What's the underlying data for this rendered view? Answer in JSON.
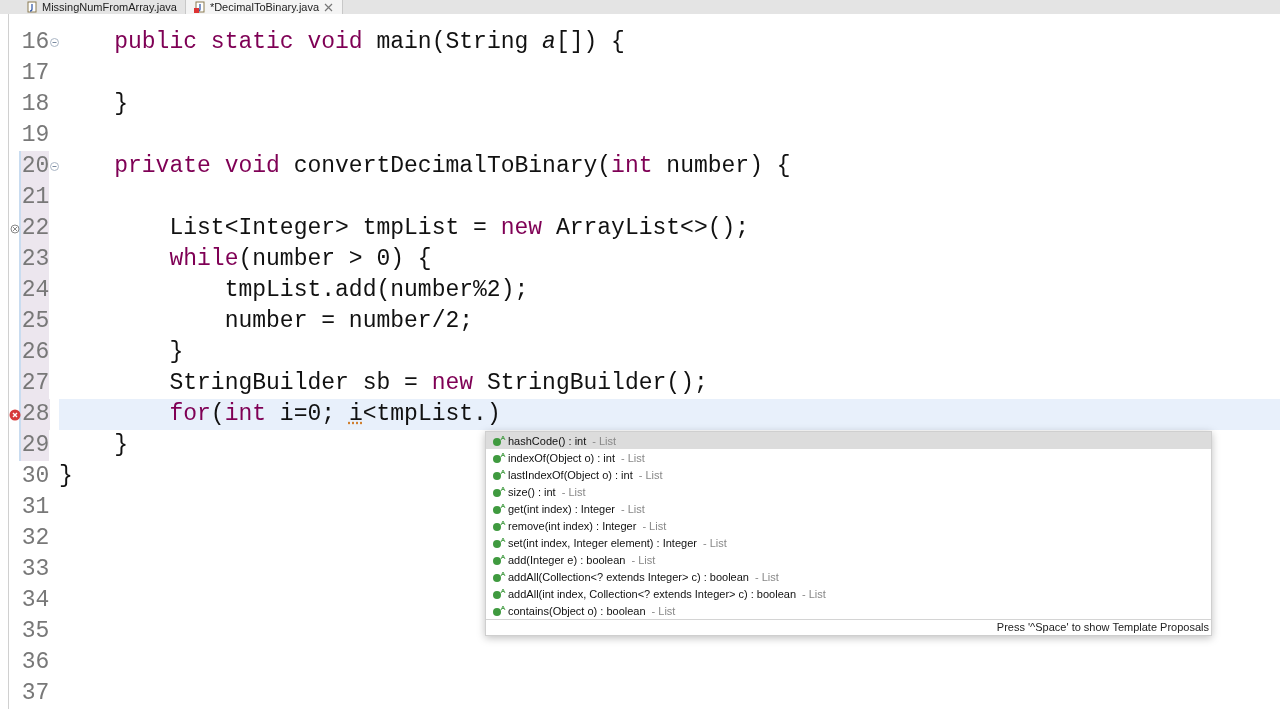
{
  "tabs": [
    {
      "label": "MissingNumFromArray.java",
      "selected": false,
      "dirty_error": false
    },
    {
      "label": "*DecimalToBinary.java",
      "selected": true,
      "dirty_error": true
    }
  ],
  "editor": {
    "lines": [
      {
        "number": "16",
        "foldable": true,
        "current": false,
        "in_range": false,
        "segments": [
          {
            "text": "    public static void",
            "kind": "keyword"
          },
          {
            "text": " main(String "
          },
          {
            "text": "a",
            "kind": "param"
          },
          {
            "text": "[]) {"
          }
        ]
      },
      {
        "number": "17",
        "current": false,
        "in_range": false
      },
      {
        "number": "18",
        "current": false,
        "in_range": false,
        "segments": [
          {
            "text": "    }"
          }
        ]
      },
      {
        "number": "19",
        "current": false,
        "in_range": false
      },
      {
        "number": "20",
        "foldable": true,
        "current": false,
        "in_range": true,
        "segments": [
          {
            "text": "    private void",
            "kind": "keyword"
          },
          {
            "text": " convertDecimalToBinary("
          },
          {
            "text": "int",
            "kind": "keyword"
          },
          {
            "text": " number) {"
          }
        ]
      },
      {
        "number": "21",
        "current": false,
        "in_range": true
      },
      {
        "number": "22",
        "warning": true,
        "current": false,
        "in_range": true,
        "segments": [
          {
            "text": "        List<Integer> tmpList = "
          },
          {
            "text": "new",
            "kind": "keyword"
          },
          {
            "text": " ArrayList<>();"
          }
        ]
      },
      {
        "number": "23",
        "current": false,
        "in_range": true,
        "segments": [
          {
            "text": "        while",
            "kind": "keyword"
          },
          {
            "text": "(number > 0) {"
          }
        ]
      },
      {
        "number": "24",
        "current": false,
        "in_range": true,
        "segments": [
          {
            "text": "            tmpList.add(number%2);"
          }
        ]
      },
      {
        "number": "25",
        "current": false,
        "in_range": true,
        "segments": [
          {
            "text": "            number = number/2;"
          }
        ]
      },
      {
        "number": "26",
        "current": false,
        "in_range": true,
        "segments": [
          {
            "text": "        }"
          }
        ]
      },
      {
        "number": "27",
        "current": false,
        "in_range": true,
        "segments": [
          {
            "text": "        StringBuilder sb = "
          },
          {
            "text": "new",
            "kind": "keyword"
          },
          {
            "text": " StringBuilder();"
          }
        ]
      },
      {
        "number": "28",
        "error": true,
        "current": true,
        "in_range": true,
        "segments": [
          {
            "text": "        for",
            "kind": "keyword"
          },
          {
            "text": "("
          },
          {
            "text": "int",
            "kind": "keyword"
          },
          {
            "text": " i=0; "
          },
          {
            "text": "i",
            "kind": "flagged"
          },
          {
            "text": "<tmpList.)"
          }
        ]
      },
      {
        "number": "29",
        "current": false,
        "in_range": true,
        "segments": [
          {
            "text": "    }"
          }
        ]
      },
      {
        "number": "30",
        "current": false,
        "in_range": false,
        "segments": [
          {
            "text": "}"
          }
        ]
      },
      {
        "number": "31",
        "current": false,
        "in_range": false
      },
      {
        "number": "32",
        "current": false,
        "in_range": false
      },
      {
        "number": "33",
        "current": false,
        "in_range": false
      },
      {
        "number": "34",
        "current": false,
        "in_range": false
      },
      {
        "number": "35",
        "current": false,
        "in_range": false
      },
      {
        "number": "36",
        "current": false,
        "in_range": false
      },
      {
        "number": "37",
        "current": false,
        "in_range": false
      }
    ]
  },
  "completion": {
    "items": [
      {
        "signature": "hashCode() : int",
        "owner": "- List",
        "selected": true
      },
      {
        "signature": "indexOf(Object o) : int",
        "owner": "- List",
        "selected": false
      },
      {
        "signature": "lastIndexOf(Object o) : int",
        "owner": "- List",
        "selected": false
      },
      {
        "signature": "size() : int",
        "owner": "- List",
        "selected": false
      },
      {
        "signature": "get(int index) : Integer",
        "owner": "- List",
        "selected": false
      },
      {
        "signature": "remove(int index) : Integer",
        "owner": "- List",
        "selected": false
      },
      {
        "signature": "set(int index, Integer element) : Integer",
        "owner": "- List",
        "selected": false
      },
      {
        "signature": "add(Integer e) : boolean",
        "owner": "- List",
        "selected": false
      },
      {
        "signature": "addAll(Collection<? extends Integer> c) : boolean",
        "owner": "- List",
        "selected": false
      },
      {
        "signature": "addAll(int index, Collection<? extends Integer> c) : boolean",
        "owner": "- List",
        "selected": false
      },
      {
        "signature": "contains(Object o) : boolean",
        "owner": "- List",
        "selected": false
      }
    ],
    "footer": "Press '^Space' to show Template Proposals"
  }
}
